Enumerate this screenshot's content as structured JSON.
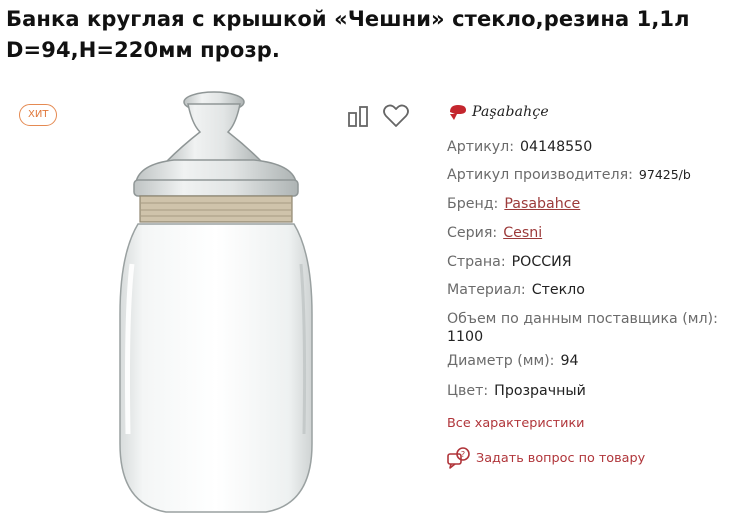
{
  "product": {
    "title": "Банка круглая с крышкой «Чешни» стекло,резина 1,1л D=94,H=220мм прозр.",
    "badge": "ХИТ",
    "brand_logo_text": "Paşabahçe"
  },
  "specs": {
    "article": {
      "label": "Артикул:",
      "value": "04148550"
    },
    "maker_article": {
      "label": "Артикул производителя:",
      "value": "97425/b"
    },
    "brand": {
      "label": "Бренд:",
      "value": "Pasabahce"
    },
    "series": {
      "label": "Серия:",
      "value": "Cesni"
    },
    "country": {
      "label": "Страна:",
      "value": "РОССИЯ"
    },
    "material": {
      "label": "Материал:",
      "value": "Стекло"
    },
    "volume": {
      "label": "Объем по данным поставщика (мл):",
      "value": "1100"
    },
    "diameter": {
      "label": "Диаметр (мм):",
      "value": "94"
    },
    "color": {
      "label": "Цвет:",
      "value": "Прозрачный"
    }
  },
  "links": {
    "all_chars": "Все характеристики",
    "ask_question": "Задать вопрос по товару"
  },
  "colors": {
    "accent": "#b0353a",
    "badge": "#e0773a",
    "link": "#9c3a3a"
  },
  "icons": {
    "compare": "compare-icon",
    "favorite": "heart-icon",
    "ask": "chat-question-icon",
    "brand": "pasabahce-logo"
  }
}
